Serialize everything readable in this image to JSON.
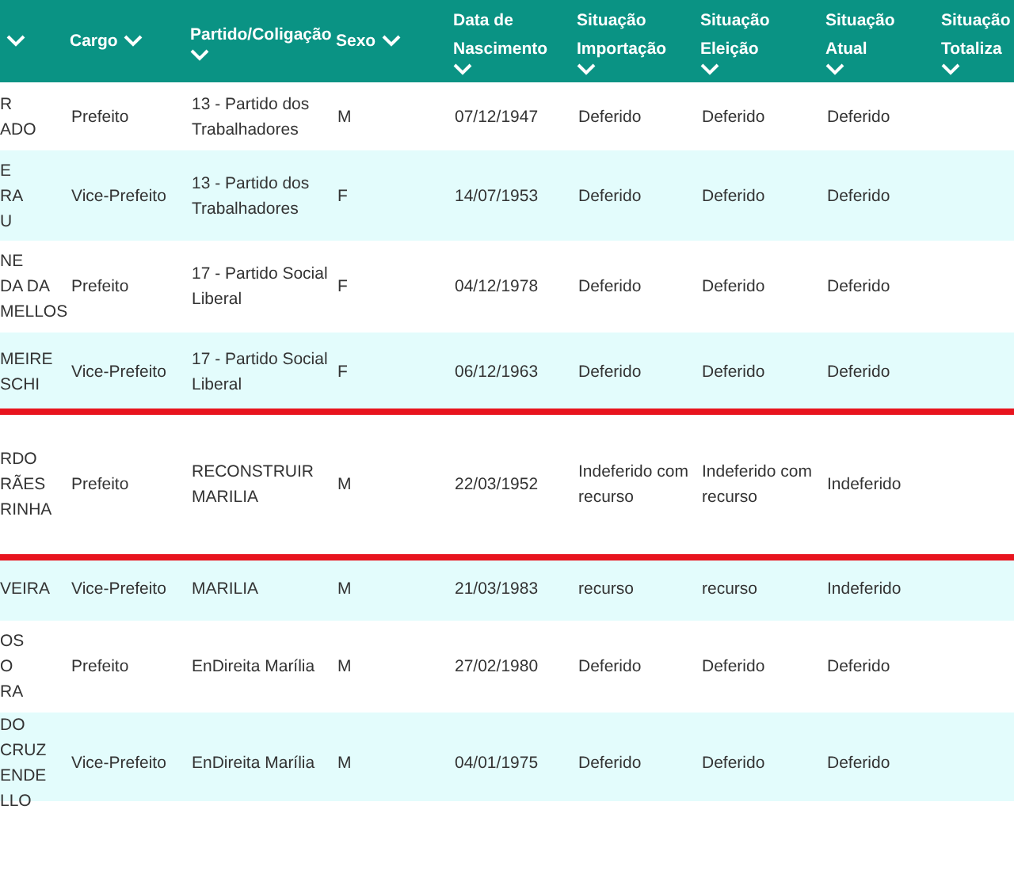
{
  "table": {
    "columns": [
      {},
      {
        "label": "Cargo"
      },
      {
        "label": "Partido/Coligação"
      },
      {
        "label": "Sexo"
      },
      {
        "label": "Data de Nascimento"
      },
      {
        "label": "Situação Importação"
      },
      {
        "label": "Situação Eleição"
      },
      {
        "label": "Situação Atual"
      },
      {
        "label": "Situação Totaliza"
      }
    ],
    "rows": [
      {
        "cells": [
          "R\nADO",
          "Prefeito",
          "13 - Partido dos Trabalhadores",
          "M",
          "07/12/1947",
          "Deferido",
          "Deferido",
          "Deferido"
        ]
      },
      {
        "cells": [
          "E\nRA\nU",
          "Vice-Prefeito",
          "13 - Partido dos Trabalhadores",
          "F",
          "14/07/1953",
          "Deferido",
          "Deferido",
          "Deferido"
        ]
      },
      {
        "cells": [
          "NE\nDA DA\nMELLOS",
          "Prefeito",
          "17 - Partido Social Liberal",
          "F",
          "04/12/1978",
          "Deferido",
          "Deferido",
          "Deferido"
        ]
      },
      {
        "cells": [
          "MEIRE\nSCHI",
          "Vice-Prefeito",
          "17 - Partido Social Liberal",
          "F",
          "06/12/1963",
          "Deferido",
          "Deferido",
          "Deferido"
        ]
      },
      {
        "cells": [
          "RDO\nRÃES\nRINHA",
          "Prefeito",
          "RECONSTRUIR MARILIA",
          "M",
          "22/03/1952",
          "Indeferido com recurso",
          "Indeferido com recurso",
          "Indeferido"
        ],
        "red_line": true
      },
      {
        "cells": [
          "VEIRA",
          "Vice-Prefeito",
          "MARILIA",
          "M",
          "21/03/1983",
          "recurso",
          "recurso",
          "Indeferido"
        ],
        "red_line": true
      },
      {
        "cells": [
          "OS\nO\nRA",
          "Prefeito",
          "EnDireita Marília",
          "M",
          "27/02/1980",
          "Deferido",
          "Deferido",
          "Deferido"
        ]
      },
      {
        "cells": [
          "DO CRUZ\nENDE\nLLO",
          "Vice-Prefeito",
          "EnDireita Marília",
          "M",
          "04/01/1975",
          "Deferido",
          "Deferido",
          "Deferido"
        ]
      }
    ]
  }
}
